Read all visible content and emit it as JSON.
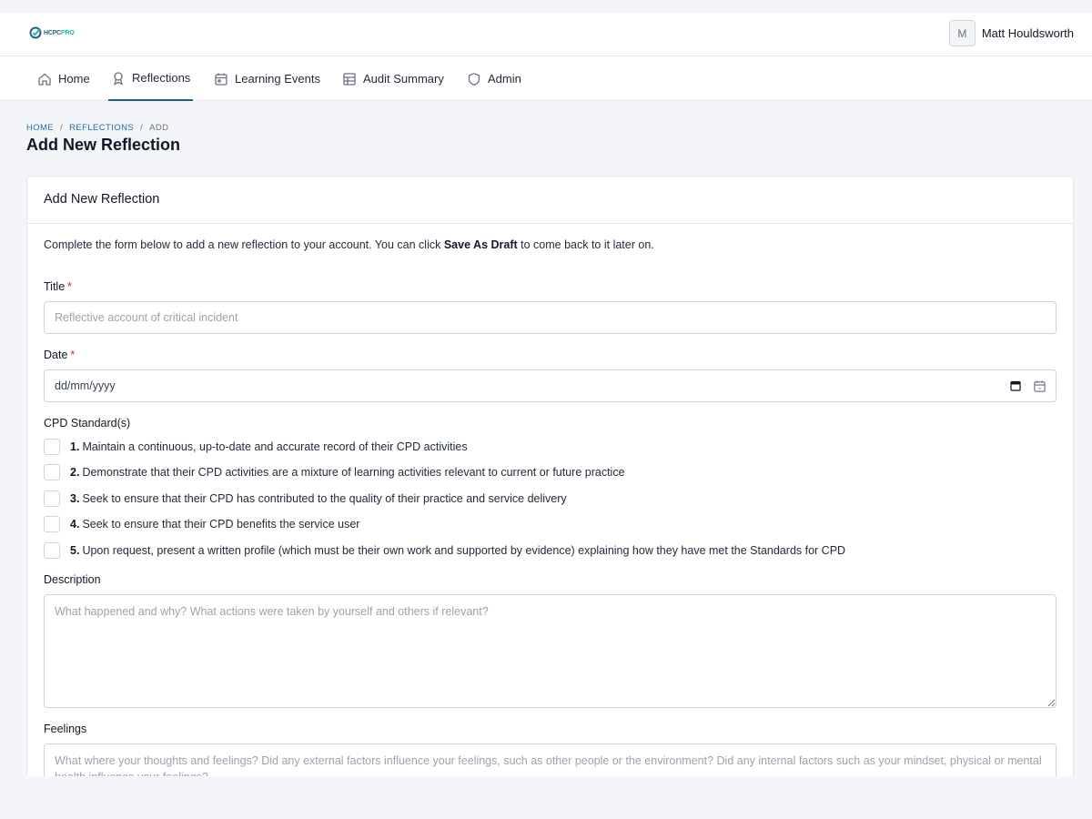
{
  "app": {
    "logo_main": "HCPC",
    "logo_accent": "PRO",
    "user": {
      "avatar_initial": "M",
      "name": "Matt Houldsworth"
    }
  },
  "nav": {
    "items": [
      {
        "label": "Home",
        "icon": "home-icon"
      },
      {
        "label": "Reflections",
        "icon": "award-icon",
        "active": true
      },
      {
        "label": "Learning Events",
        "icon": "calendar-icon"
      },
      {
        "label": "Audit Summary",
        "icon": "table-icon"
      },
      {
        "label": "Admin",
        "icon": "shield-icon"
      }
    ]
  },
  "breadcrumb": {
    "home": "HOME",
    "reflections": "REFLECTIONS",
    "current": "ADD",
    "separator": "/"
  },
  "page": {
    "title": "Add New Reflection"
  },
  "form": {
    "card_title": "Add New Reflection",
    "intro_before": "Complete the form below to add a new reflection to your account. You can click ",
    "intro_bold": "Save As Draft",
    "intro_after": " to come back to it later on.",
    "title": {
      "label": "Title",
      "required_mark": "*",
      "placeholder": "Reflective account of critical incident",
      "value": ""
    },
    "date": {
      "label": "Date",
      "required_mark": "*",
      "placeholder": "dd/mm/yyyy"
    },
    "cpd": {
      "label": "CPD Standard(s)",
      "standards": [
        {
          "num": "1.",
          "text": "Maintain a continuous, up-to-date and accurate record of their CPD activities",
          "checked": false
        },
        {
          "num": "2.",
          "text": "Demonstrate that their CPD activities are a mixture of learning activities relevant to current or future practice",
          "checked": false
        },
        {
          "num": "3.",
          "text": "Seek to ensure that their CPD has contributed to the quality of their practice and service delivery",
          "checked": false
        },
        {
          "num": "4.",
          "text": "Seek to ensure that their CPD benefits the service user",
          "checked": false
        },
        {
          "num": "5.",
          "text": "Upon request, present a written profile (which must be their own work and supported by evidence) explaining how they have met the Standards for CPD",
          "checked": false
        }
      ]
    },
    "description": {
      "label": "Description",
      "placeholder": "What happened and why? What actions were taken by yourself and others if relevant?"
    },
    "feelings": {
      "label": "Feelings",
      "placeholder": "What where your thoughts and feelings? Did any external factors influence your feelings, such as other people or the environment? Did any internal factors such as your mindset, physical or mental health influence your feelings?"
    }
  },
  "colors": {
    "primary": "#1f5f86",
    "link": "#1f6ea3",
    "required": "#dc2626",
    "logo_accent": "#22b3b1"
  }
}
